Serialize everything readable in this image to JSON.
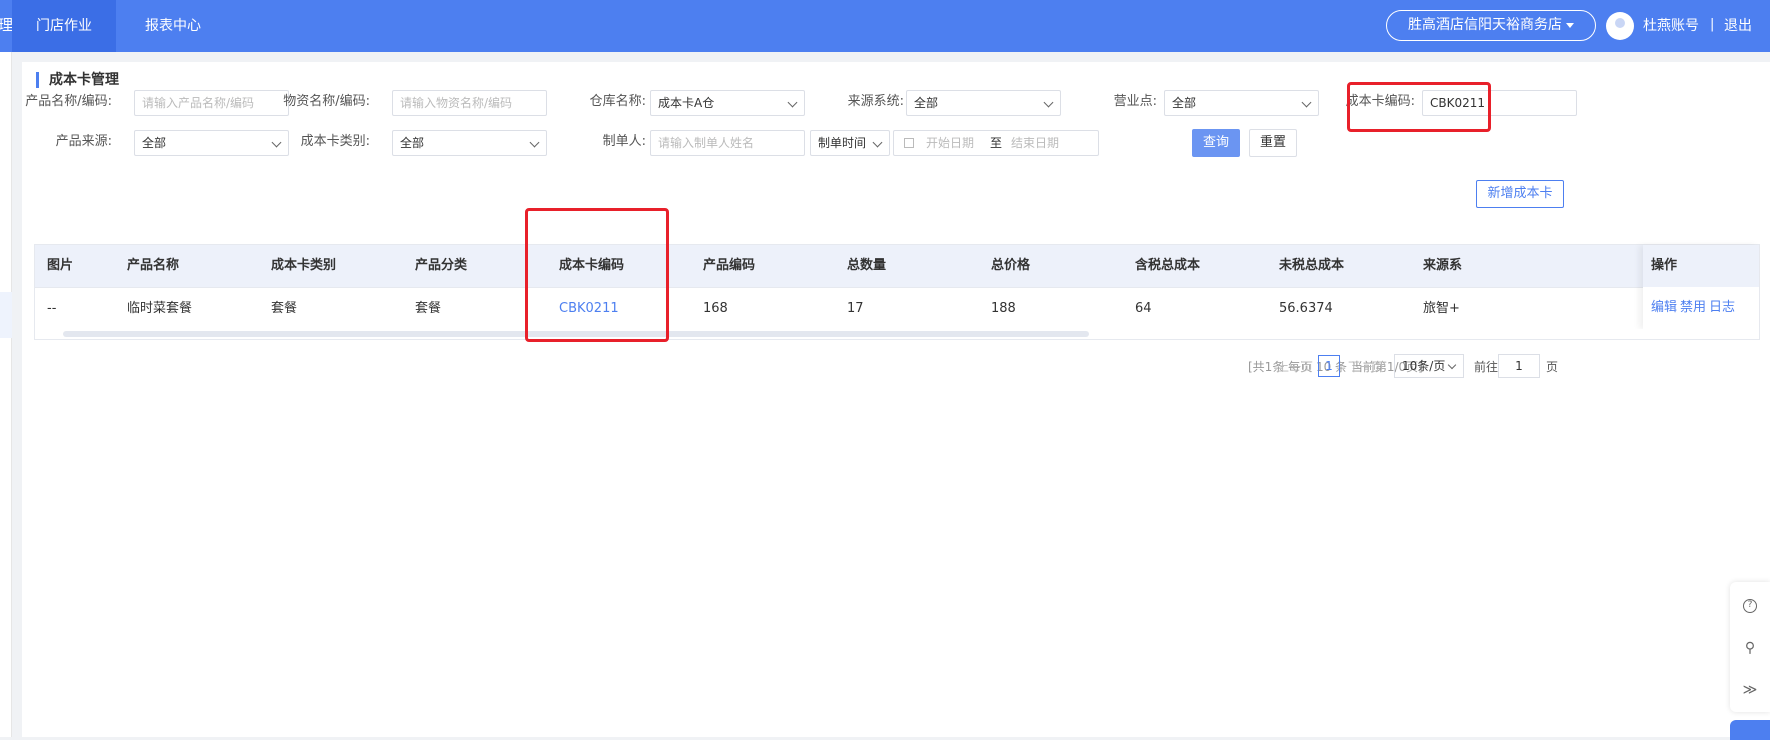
{
  "topbar": {
    "edge_text": "理",
    "tabs": [
      "门店作业",
      "报表中心"
    ],
    "store": "胜高酒店信阳天裕商务店",
    "user": "杜燕账号",
    "separator": "|",
    "logout": "退出"
  },
  "page": {
    "title": "成本卡管理"
  },
  "filters": {
    "product_label": "产品名称/编码:",
    "product_placeholder": "请输入产品名称/编码",
    "material_label": "物资名称/编码:",
    "material_placeholder": "请输入物资名称/编码",
    "warehouse_label": "仓库名称:",
    "warehouse_value": "成本卡A仓",
    "source_label": "来源系统:",
    "source_value": "全部",
    "outlet_label": "营业点:",
    "outlet_value": "全部",
    "code_label": "成本卡编码:",
    "code_value": "CBK0211",
    "origin_label": "产品来源:",
    "origin_value": "全部",
    "type_label": "成本卡类别:",
    "type_value": "全部",
    "creator_label": "制单人:",
    "creator_placeholder": "请输入制单人姓名",
    "time_type": "制单时间",
    "date_start": "开始日期",
    "date_to": "至",
    "date_end": "结束日期",
    "query_button": "查询",
    "reset_button": "重置"
  },
  "add_button": "新增成本卡",
  "table": {
    "headers": [
      "图片",
      "产品名称",
      "成本卡类别",
      "产品分类",
      "成本卡编码",
      "产品编码",
      "总数量",
      "总价格",
      "含税总成本",
      "未税总成本",
      "来源系",
      "操作"
    ],
    "row": {
      "image": "--",
      "name": "临时菜套餐",
      "card_type": "套餐",
      "category": "套餐",
      "code": "CBK0211",
      "product_code": "168",
      "qty": "17",
      "price": "188",
      "tax_cost": "64",
      "notax_cost": "56.6374",
      "source": "旅智+",
      "edit": "编辑",
      "disable": "禁用",
      "log": "日志"
    }
  },
  "pagination": {
    "info": "[共1条 每页 10 条 当前第1/0页]",
    "prev": "上一页",
    "page": "1",
    "next": "下一页",
    "size": "10条/页",
    "goto_label": "前往",
    "goto_value": "1",
    "goto_suffix": "页"
  },
  "tools": {
    "help": "?",
    "link": "⚲",
    "collapse": "≫"
  }
}
